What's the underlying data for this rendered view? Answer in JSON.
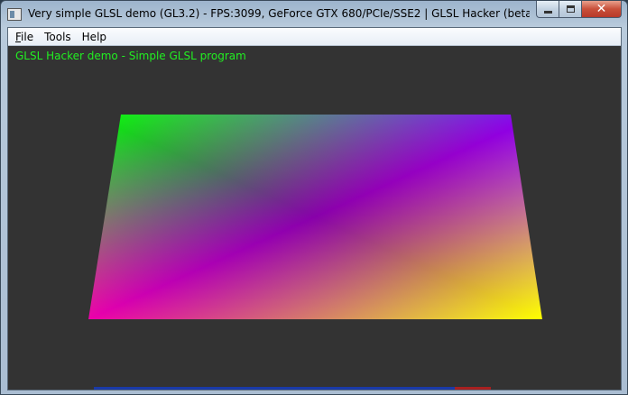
{
  "window": {
    "title": "Very simple GLSL demo (GL3.2) - FPS:3099, GeForce GTX 680/PCIe/SSE2 | GLSL Hacker (beta) (Windows...",
    "buttons": {
      "minimize": "minimize",
      "maximize": "maximize",
      "close": "✕"
    }
  },
  "menu": {
    "file": {
      "mnemonic": "F",
      "rest": "ile"
    },
    "tools": "Tools",
    "help": "Help"
  },
  "viewport": {
    "overlay_text": "GLSL Hacker demo - Simple GLSL program",
    "background_color": "#333333",
    "overlay_color": "#22ee22"
  },
  "quad": {
    "corner_colors": {
      "top_left": "#00ff00",
      "top_right": "#0000ff",
      "bottom_left": "#ff0000",
      "bottom_right": "#ffff00"
    }
  },
  "icons": [
    "app-window-icon",
    "minimize-icon",
    "maximize-icon",
    "close-icon"
  ]
}
